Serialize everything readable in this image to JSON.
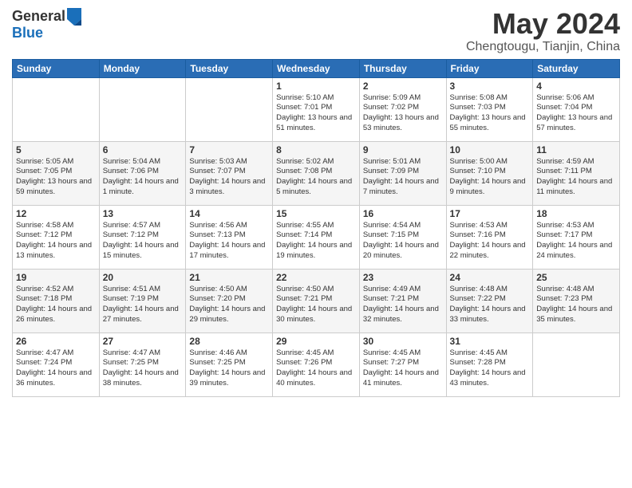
{
  "header": {
    "logo_line1": "General",
    "logo_line2": "Blue",
    "title": "May 2024",
    "location": "Chengtougu, Tianjin, China"
  },
  "weekdays": [
    "Sunday",
    "Monday",
    "Tuesday",
    "Wednesday",
    "Thursday",
    "Friday",
    "Saturday"
  ],
  "weeks": [
    [
      {
        "day": "",
        "info": ""
      },
      {
        "day": "",
        "info": ""
      },
      {
        "day": "",
        "info": ""
      },
      {
        "day": "1",
        "info": "Sunrise: 5:10 AM\nSunset: 7:01 PM\nDaylight: 13 hours\nand 51 minutes."
      },
      {
        "day": "2",
        "info": "Sunrise: 5:09 AM\nSunset: 7:02 PM\nDaylight: 13 hours\nand 53 minutes."
      },
      {
        "day": "3",
        "info": "Sunrise: 5:08 AM\nSunset: 7:03 PM\nDaylight: 13 hours\nand 55 minutes."
      },
      {
        "day": "4",
        "info": "Sunrise: 5:06 AM\nSunset: 7:04 PM\nDaylight: 13 hours\nand 57 minutes."
      }
    ],
    [
      {
        "day": "5",
        "info": "Sunrise: 5:05 AM\nSunset: 7:05 PM\nDaylight: 13 hours\nand 59 minutes."
      },
      {
        "day": "6",
        "info": "Sunrise: 5:04 AM\nSunset: 7:06 PM\nDaylight: 14 hours\nand 1 minute."
      },
      {
        "day": "7",
        "info": "Sunrise: 5:03 AM\nSunset: 7:07 PM\nDaylight: 14 hours\nand 3 minutes."
      },
      {
        "day": "8",
        "info": "Sunrise: 5:02 AM\nSunset: 7:08 PM\nDaylight: 14 hours\nand 5 minutes."
      },
      {
        "day": "9",
        "info": "Sunrise: 5:01 AM\nSunset: 7:09 PM\nDaylight: 14 hours\nand 7 minutes."
      },
      {
        "day": "10",
        "info": "Sunrise: 5:00 AM\nSunset: 7:10 PM\nDaylight: 14 hours\nand 9 minutes."
      },
      {
        "day": "11",
        "info": "Sunrise: 4:59 AM\nSunset: 7:11 PM\nDaylight: 14 hours\nand 11 minutes."
      }
    ],
    [
      {
        "day": "12",
        "info": "Sunrise: 4:58 AM\nSunset: 7:12 PM\nDaylight: 14 hours\nand 13 minutes."
      },
      {
        "day": "13",
        "info": "Sunrise: 4:57 AM\nSunset: 7:12 PM\nDaylight: 14 hours\nand 15 minutes."
      },
      {
        "day": "14",
        "info": "Sunrise: 4:56 AM\nSunset: 7:13 PM\nDaylight: 14 hours\nand 17 minutes."
      },
      {
        "day": "15",
        "info": "Sunrise: 4:55 AM\nSunset: 7:14 PM\nDaylight: 14 hours\nand 19 minutes."
      },
      {
        "day": "16",
        "info": "Sunrise: 4:54 AM\nSunset: 7:15 PM\nDaylight: 14 hours\nand 20 minutes."
      },
      {
        "day": "17",
        "info": "Sunrise: 4:53 AM\nSunset: 7:16 PM\nDaylight: 14 hours\nand 22 minutes."
      },
      {
        "day": "18",
        "info": "Sunrise: 4:53 AM\nSunset: 7:17 PM\nDaylight: 14 hours\nand 24 minutes."
      }
    ],
    [
      {
        "day": "19",
        "info": "Sunrise: 4:52 AM\nSunset: 7:18 PM\nDaylight: 14 hours\nand 26 minutes."
      },
      {
        "day": "20",
        "info": "Sunrise: 4:51 AM\nSunset: 7:19 PM\nDaylight: 14 hours\nand 27 minutes."
      },
      {
        "day": "21",
        "info": "Sunrise: 4:50 AM\nSunset: 7:20 PM\nDaylight: 14 hours\nand 29 minutes."
      },
      {
        "day": "22",
        "info": "Sunrise: 4:50 AM\nSunset: 7:21 PM\nDaylight: 14 hours\nand 30 minutes."
      },
      {
        "day": "23",
        "info": "Sunrise: 4:49 AM\nSunset: 7:21 PM\nDaylight: 14 hours\nand 32 minutes."
      },
      {
        "day": "24",
        "info": "Sunrise: 4:48 AM\nSunset: 7:22 PM\nDaylight: 14 hours\nand 33 minutes."
      },
      {
        "day": "25",
        "info": "Sunrise: 4:48 AM\nSunset: 7:23 PM\nDaylight: 14 hours\nand 35 minutes."
      }
    ],
    [
      {
        "day": "26",
        "info": "Sunrise: 4:47 AM\nSunset: 7:24 PM\nDaylight: 14 hours\nand 36 minutes."
      },
      {
        "day": "27",
        "info": "Sunrise: 4:47 AM\nSunset: 7:25 PM\nDaylight: 14 hours\nand 38 minutes."
      },
      {
        "day": "28",
        "info": "Sunrise: 4:46 AM\nSunset: 7:25 PM\nDaylight: 14 hours\nand 39 minutes."
      },
      {
        "day": "29",
        "info": "Sunrise: 4:45 AM\nSunset: 7:26 PM\nDaylight: 14 hours\nand 40 minutes."
      },
      {
        "day": "30",
        "info": "Sunrise: 4:45 AM\nSunset: 7:27 PM\nDaylight: 14 hours\nand 41 minutes."
      },
      {
        "day": "31",
        "info": "Sunrise: 4:45 AM\nSunset: 7:28 PM\nDaylight: 14 hours\nand 43 minutes."
      },
      {
        "day": "",
        "info": ""
      }
    ]
  ]
}
